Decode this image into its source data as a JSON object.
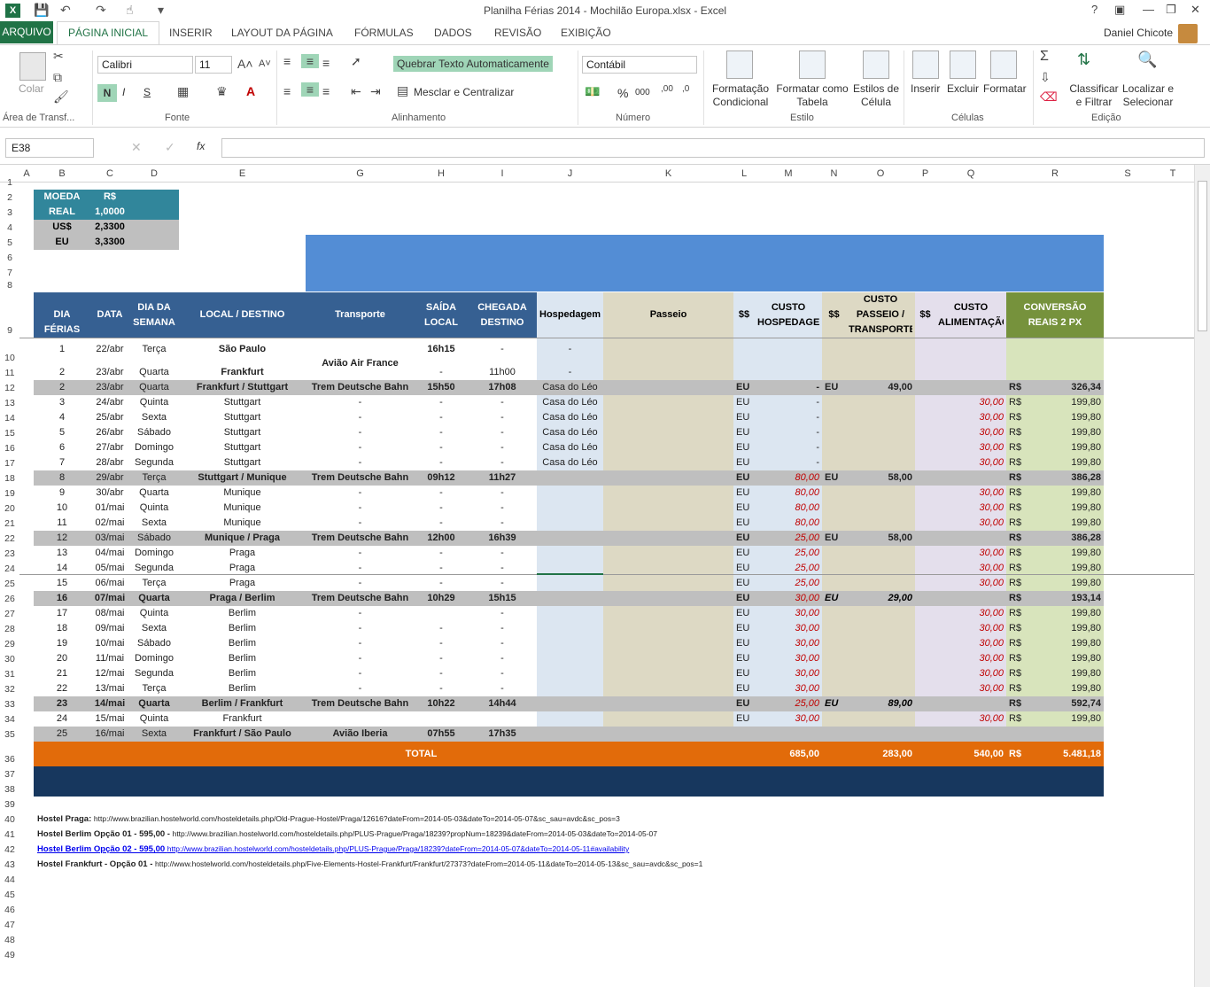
{
  "window": {
    "title": "Planilha Férias 2014 - Mochilão Europa.xlsx - Excel",
    "user": "Daniel Chicote"
  },
  "tabs": [
    "ARQUIVO",
    "PÁGINA INICIAL",
    "INSERIR",
    "LAYOUT DA PÁGINA",
    "FÓRMULAS",
    "DADOS",
    "REVISÃO",
    "EXIBIÇÃO"
  ],
  "ribbon": {
    "paste": "Colar",
    "clipboard": "Área de Transf...",
    "font_name": "Calibri",
    "font_size": "11",
    "font_group": "Fonte",
    "bold": "N",
    "italic": "I",
    "underline": "S",
    "wrap": "Quebrar Texto Automaticamente",
    "merge": "Mesclar e Centralizar",
    "align_group": "Alinhamento",
    "number_format": "Contábil",
    "number_group": "Número",
    "percent": "%",
    "thousands": "000",
    "cond_format": "Formatação Condicional",
    "format_table": "Formatar como Tabela",
    "cell_styles": "Estilos de Célula",
    "style_group": "Estilo",
    "insert": "Inserir",
    "delete": "Excluir",
    "format": "Formatar",
    "cells_group": "Células",
    "sort": "Classificar e Filtrar",
    "find": "Localizar e Selecionar",
    "edit_group": "Edição"
  },
  "formula_bar": {
    "name_box": "E38",
    "fx": "fx",
    "content": ""
  },
  "columns": [
    "A",
    "B",
    "C",
    "D",
    "E",
    "F",
    "G",
    "H",
    "I",
    "J",
    "K",
    "L",
    "M",
    "N",
    "O",
    "P",
    "Q",
    "R",
    "S",
    "T"
  ],
  "currency_table": {
    "header": [
      "MOEDA",
      "R$"
    ],
    "rows": [
      [
        "REAL",
        "1,0000"
      ],
      [
        "US$",
        "2,3300"
      ],
      [
        "EU",
        "3,3300"
      ]
    ]
  },
  "headers": {
    "dia": "DIA FÉRIAS",
    "data": "DATA",
    "semana": "DIA DA SEMANA",
    "local": "LOCAL / DESTINO",
    "transporte": "Transporte",
    "saida": "SAÍDA LOCAL",
    "chegada": "CHEGADA DESTINO",
    "hosp": "Hospedagem",
    "passeio": "Passeio",
    "ss1": "$$",
    "custo_hosp": "CUSTO HOSPEDAGEM",
    "ss2": "$$",
    "custo_passeio": "CUSTO PASSEIO / TRANSPORTE",
    "ss3": "$$",
    "custo_alim": "CUSTO ALIMENTAÇÃO",
    "conversao": "CONVERSÃO REAIS 2 PX"
  },
  "row10": {
    "dia": "1",
    "data": "22/abr",
    "semana": "Terça",
    "local": "São Paulo",
    "saida": "16h15",
    "chegada": "-",
    "hosp": "-",
    "transporte": "Avião Air France"
  },
  "row11": {
    "dia": "2",
    "data": "23/abr",
    "semana": "Quarta",
    "local": "Frankfurt",
    "saida": "-",
    "chegada": "11h00",
    "hosp": "-"
  },
  "rows": [
    {
      "n": "12",
      "g": 1,
      "dia": "2",
      "data": "23/abr",
      "semana": "Quarta",
      "local": "Frankfurt / Stuttgart",
      "transp": "Trem Deutsche Bahn",
      "saida": "15h50",
      "chegada": "17h08",
      "hosp": "Casa do Léo",
      "m1": "EU",
      "v1": "-",
      "m2": "EU",
      "v2": "49,00",
      "v3": "",
      "rs": "R$",
      "total": "326,34"
    },
    {
      "n": "13",
      "g": 0,
      "dia": "3",
      "data": "24/abr",
      "semana": "Quinta",
      "local": "Stuttgart",
      "transp": "-",
      "saida": "-",
      "chegada": "-",
      "hosp": "Casa do Léo",
      "m1": "EU",
      "v1": "-",
      "m2": "",
      "v2": "",
      "v3": "30,00",
      "rs": "R$",
      "total": "199,80"
    },
    {
      "n": "14",
      "g": 0,
      "dia": "4",
      "data": "25/abr",
      "semana": "Sexta",
      "local": "Stuttgart",
      "transp": "-",
      "saida": "-",
      "chegada": "-",
      "hosp": "Casa do Léo",
      "m1": "EU",
      "v1": "-",
      "m2": "",
      "v2": "",
      "v3": "30,00",
      "rs": "R$",
      "total": "199,80"
    },
    {
      "n": "15",
      "g": 0,
      "dia": "5",
      "data": "26/abr",
      "semana": "Sábado",
      "local": "Stuttgart",
      "transp": "-",
      "saida": "-",
      "chegada": "-",
      "hosp": "Casa do Léo",
      "m1": "EU",
      "v1": "-",
      "m2": "",
      "v2": "",
      "v3": "30,00",
      "rs": "R$",
      "total": "199,80"
    },
    {
      "n": "16",
      "g": 0,
      "dia": "6",
      "data": "27/abr",
      "semana": "Domingo",
      "local": "Stuttgart",
      "transp": "-",
      "saida": "-",
      "chegada": "-",
      "hosp": "Casa do Léo",
      "m1": "EU",
      "v1": "-",
      "m2": "",
      "v2": "",
      "v3": "30,00",
      "rs": "R$",
      "total": "199,80"
    },
    {
      "n": "17",
      "g": 0,
      "dia": "7",
      "data": "28/abr",
      "semana": "Segunda",
      "local": "Stuttgart",
      "transp": "-",
      "saida": "-",
      "chegada": "-",
      "hosp": "Casa do Léo",
      "m1": "EU",
      "v1": "-",
      "m2": "",
      "v2": "",
      "v3": "30,00",
      "rs": "R$",
      "total": "199,80"
    },
    {
      "n": "18",
      "g": 1,
      "dia": "8",
      "data": "29/abr",
      "semana": "Terça",
      "local": "Stuttgart / Munique",
      "transp": "Trem Deutsche Bahn",
      "saida": "09h12",
      "chegada": "11h27",
      "hosp": "",
      "m1": "EU",
      "v1": "80,00",
      "m2": "EU",
      "v2": "58,00",
      "v3": "",
      "rs": "R$",
      "total": "386,28"
    },
    {
      "n": "19",
      "g": 0,
      "dia": "9",
      "data": "30/abr",
      "semana": "Quarta",
      "local": "Munique",
      "transp": "-",
      "saida": "-",
      "chegada": "-",
      "hosp": "",
      "m1": "EU",
      "v1": "80,00",
      "m2": "",
      "v2": "",
      "v3": "30,00",
      "rs": "R$",
      "total": "199,80"
    },
    {
      "n": "20",
      "g": 0,
      "dia": "10",
      "data": "01/mai",
      "semana": "Quinta",
      "local": "Munique",
      "transp": "-",
      "saida": "-",
      "chegada": "-",
      "hosp": "",
      "m1": "EU",
      "v1": "80,00",
      "m2": "",
      "v2": "",
      "v3": "30,00",
      "rs": "R$",
      "total": "199,80"
    },
    {
      "n": "21",
      "g": 0,
      "dia": "11",
      "data": "02/mai",
      "semana": "Sexta",
      "local": "Munique",
      "transp": "-",
      "saida": "-",
      "chegada": "-",
      "hosp": "",
      "m1": "EU",
      "v1": "80,00",
      "m2": "",
      "v2": "",
      "v3": "30,00",
      "rs": "R$",
      "total": "199,80"
    },
    {
      "n": "22",
      "g": 1,
      "dia": "12",
      "data": "03/mai",
      "semana": "Sábado",
      "local": "Munique / Praga",
      "transp": "Trem Deutsche Bahn",
      "saida": "12h00",
      "chegada": "16h39",
      "hosp": "",
      "m1": "EU",
      "v1": "25,00",
      "m2": "EU",
      "v2": "58,00",
      "v3": "",
      "rs": "R$",
      "total": "386,28"
    },
    {
      "n": "23",
      "g": 0,
      "dia": "13",
      "data": "04/mai",
      "semana": "Domingo",
      "local": "Praga",
      "transp": "-",
      "saida": "-",
      "chegada": "-",
      "hosp": "",
      "m1": "EU",
      "v1": "25,00",
      "m2": "",
      "v2": "",
      "v3": "30,00",
      "rs": "R$",
      "total": "199,80"
    },
    {
      "n": "24",
      "g": 0,
      "dia": "14",
      "data": "05/mai",
      "semana": "Segunda",
      "local": "Praga",
      "transp": "-",
      "saida": "-",
      "chegada": "-",
      "hosp": "",
      "m1": "EU",
      "v1": "25,00",
      "m2": "",
      "v2": "",
      "v3": "30,00",
      "rs": "R$",
      "total": "199,80"
    },
    {
      "n": "25",
      "g": 0,
      "dia": "15",
      "data": "06/mai",
      "semana": "Terça",
      "local": "Praga",
      "transp": "-",
      "saida": "-",
      "chegada": "-",
      "hosp": "",
      "m1": "EU",
      "v1": "25,00",
      "m2": "",
      "v2": "",
      "v3": "30,00",
      "rs": "R$",
      "total": "199,80"
    },
    {
      "n": "26",
      "g": 2,
      "dia": "16",
      "data": "07/mai",
      "semana": "Quarta",
      "local": "Praga / Berlim",
      "transp": "Trem Deutsche Bahn",
      "saida": "10h29",
      "chegada": "15h15",
      "hosp": "",
      "m1": "EU",
      "v1": "30,00",
      "m2": "EU",
      "v2": "29,00",
      "v3": "",
      "rs": "R$",
      "total": "193,14"
    },
    {
      "n": "27",
      "g": 0,
      "dia": "17",
      "data": "08/mai",
      "semana": "Quinta",
      "local": "Berlim",
      "transp": "-",
      "saida": "",
      "chegada": "-",
      "hosp": "",
      "m1": "EU",
      "v1": "30,00",
      "m2": "",
      "v2": "",
      "v3": "30,00",
      "rs": "R$",
      "total": "199,80"
    },
    {
      "n": "28",
      "g": 0,
      "dia": "18",
      "data": "09/mai",
      "semana": "Sexta",
      "local": "Berlim",
      "transp": "-",
      "saida": "-",
      "chegada": "-",
      "hosp": "",
      "m1": "EU",
      "v1": "30,00",
      "m2": "",
      "v2": "",
      "v3": "30,00",
      "rs": "R$",
      "total": "199,80"
    },
    {
      "n": "29",
      "g": 0,
      "dia": "19",
      "data": "10/mai",
      "semana": "Sábado",
      "local": "Berlim",
      "transp": "-",
      "saida": "-",
      "chegada": "-",
      "hosp": "",
      "m1": "EU",
      "v1": "30,00",
      "m2": "",
      "v2": "",
      "v3": "30,00",
      "rs": "R$",
      "total": "199,80"
    },
    {
      "n": "30",
      "g": 0,
      "dia": "20",
      "data": "11/mai",
      "semana": "Domingo",
      "local": "Berlim",
      "transp": "-",
      "saida": "-",
      "chegada": "-",
      "hosp": "",
      "m1": "EU",
      "v1": "30,00",
      "m2": "",
      "v2": "",
      "v3": "30,00",
      "rs": "R$",
      "total": "199,80"
    },
    {
      "n": "31",
      "g": 0,
      "dia": "21",
      "data": "12/mai",
      "semana": "Segunda",
      "local": "Berlim",
      "transp": "-",
      "saida": "-",
      "chegada": "-",
      "hosp": "",
      "m1": "EU",
      "v1": "30,00",
      "m2": "",
      "v2": "",
      "v3": "30,00",
      "rs": "R$",
      "total": "199,80"
    },
    {
      "n": "32",
      "g": 0,
      "dia": "22",
      "data": "13/mai",
      "semana": "Terça",
      "local": "Berlim",
      "transp": "-",
      "saida": "-",
      "chegada": "-",
      "hosp": "",
      "m1": "EU",
      "v1": "30,00",
      "m2": "",
      "v2": "",
      "v3": "30,00",
      "rs": "R$",
      "total": "199,80"
    },
    {
      "n": "33",
      "g": 2,
      "dia": "23",
      "data": "14/mai",
      "semana": "Quarta",
      "local": "Berlim / Frankfurt",
      "transp": "Trem Deutsche Bahn",
      "saida": "10h22",
      "chegada": "14h44",
      "hosp": "",
      "m1": "EU",
      "v1": "25,00",
      "m2": "EU",
      "v2": "89,00",
      "v3": "",
      "rs": "R$",
      "total": "592,74"
    },
    {
      "n": "34",
      "g": 0,
      "dia": "24",
      "data": "15/mai",
      "semana": "Quinta",
      "local": "Frankfurt",
      "transp": "",
      "saida": "",
      "chegada": "",
      "hosp": "",
      "m1": "EU",
      "v1": "30,00",
      "m2": "",
      "v2": "",
      "v3": "30,00",
      "rs": "R$",
      "total": "199,80"
    },
    {
      "n": "35",
      "g": 1,
      "dia": "25",
      "data": "16/mai",
      "semana": "Sexta",
      "local": "Frankfurt / São Paulo",
      "transp": "Avião Iberia",
      "saida": "07h55",
      "chegada": "17h35",
      "hosp": "",
      "m1": "",
      "v1": "",
      "m2": "",
      "v2": "",
      "v3": "",
      "rs": "",
      "total": ""
    }
  ],
  "totals": {
    "label": "TOTAL",
    "hosp": "685,00",
    "passeio": "283,00",
    "alim": "540,00",
    "rs": "R$",
    "total": "5.481,18"
  },
  "links": [
    {
      "label": "Hostel Praga:",
      "url": "http://www.brazilian.hostelworld.com/hosteldetails.php/Old-Prague-Hostel/Praga/12616?dateFrom=2014-05-03&dateTo=2014-05-07&sc_sau=avdc&sc_pos=3"
    },
    {
      "label": "Hostel Berlim Opção 01 - 595,00 -",
      "url": "http://www.brazilian.hostelworld.com/hosteldetails.php/PLUS-Prague/Praga/18239?propNum=18239&dateFrom=2014-05-03&dateTo=2014-05-07"
    },
    {
      "label": "Hostel Berlim Opção 02 - 595,00",
      "url": "http://www.brazilian.hostelworld.com/hosteldetails.php/PLUS-Prague/Praga/18239?dateFrom=2014-05-07&dateTo=2014-05-11#availability"
    },
    {
      "label": "Hostel Frankfurt - Opção 01 -",
      "url": "http://www.hostelworld.com/hosteldetails.php/Five-Elements-Hostel-Frankfurt/Frankfurt/27373?dateFrom=2014-05-11&dateTo=2014-05-13&sc_sau=avdc&sc_pos=1"
    }
  ],
  "row_numbers": [
    "1",
    "2",
    "3",
    "4",
    "5",
    "6",
    "7",
    "8",
    "9",
    "10",
    "11",
    "12",
    "13",
    "14",
    "15",
    "16",
    "17",
    "18",
    "19",
    "20",
    "21",
    "22",
    "23",
    "24",
    "25",
    "26",
    "27",
    "28",
    "29",
    "30",
    "31",
    "32",
    "33",
    "34",
    "35",
    "36",
    "37",
    "38",
    "39",
    "40",
    "41",
    "42",
    "43",
    "44",
    "45",
    "46",
    "47",
    "48",
    "49"
  ],
  "colors": {
    "excel_green": "#217346",
    "header_blue": "#366092",
    "teal": "#31869b",
    "orange": "#e26b0a",
    "navy": "#17375e",
    "banner": "#538dd5",
    "hosp_bg": "#dce6f1",
    "passeio_bg": "#ddd9c4",
    "alim_bg": "#e4dfec",
    "conv_bg": "#d8e4bc",
    "conv_hdr": "#76923c",
    "gray_row": "#bfbfbf"
  }
}
